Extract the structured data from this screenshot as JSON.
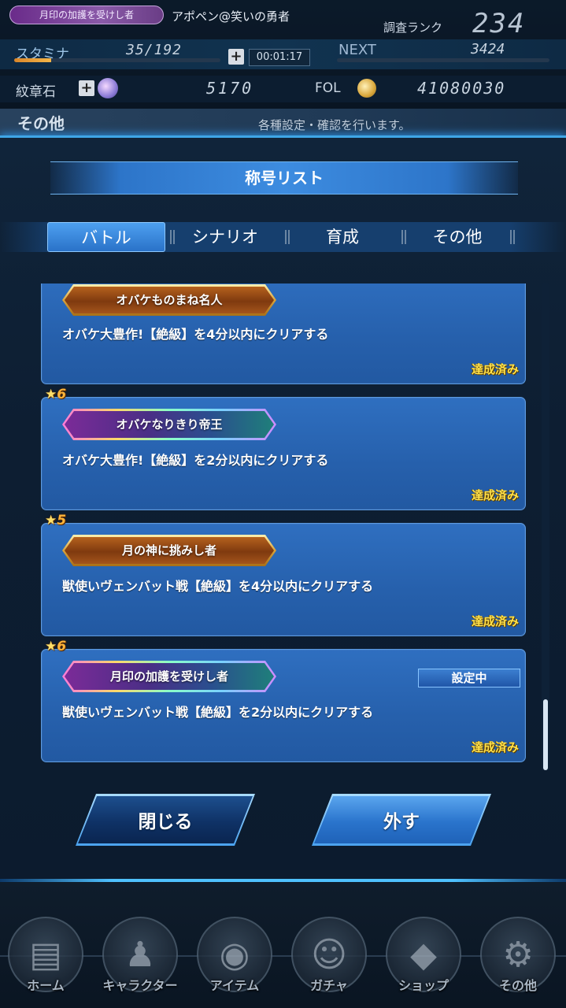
{
  "header": {
    "title_badge": "月印の加護を受けし者",
    "player_name": "アポペン@笑いの勇者",
    "rank_label": "調査ランク",
    "rank_value": "234",
    "stamina_label": "スタミナ",
    "stamina_value": "35/192",
    "stamina_fraction": 0.18,
    "timer": "00:01:17",
    "next_label": "NEXT",
    "next_value": "3424",
    "crest_label": "紋章石",
    "crest_value": "5170",
    "fol_label": "FOL",
    "fol_value": "41080030",
    "section_title": "その他",
    "section_desc": "各種設定・確認を行います。"
  },
  "modal": {
    "title": "称号リスト",
    "tabs": [
      {
        "label": "バトル",
        "active": true
      },
      {
        "label": "シナリオ",
        "active": false
      },
      {
        "label": "育成",
        "active": false
      },
      {
        "label": "その他",
        "active": false
      }
    ],
    "titles": [
      {
        "rarity": "",
        "name": "オバケものまね名人",
        "plate": "gold",
        "condition": "オバケ大豊作!【絶級】を4分以内にクリアする",
        "status": "達成済み",
        "equipped": false
      },
      {
        "rarity": "6",
        "name": "オバケなりきり帝王",
        "plate": "rainbow",
        "condition": "オバケ大豊作!【絶級】を2分以内にクリアする",
        "status": "達成済み",
        "equipped": false
      },
      {
        "rarity": "5",
        "name": "月の神に挑みし者",
        "plate": "gold",
        "condition": "獣使いヴェンバット戦【絶級】を4分以内にクリアする",
        "status": "達成済み",
        "equipped": false
      },
      {
        "rarity": "6",
        "name": "月印の加護を受けし者",
        "plate": "rainbow",
        "condition": "獣使いヴェンバット戦【絶級】を2分以内にクリアする",
        "status": "達成済み",
        "equipped": true,
        "equipped_label": "設定中"
      }
    ],
    "close_label": "閉じる",
    "remove_label": "外す"
  },
  "nav": [
    {
      "label": "ホーム",
      "icon": "home-door-icon"
    },
    {
      "label": "キャラクター",
      "icon": "character-group-icon"
    },
    {
      "label": "アイテム",
      "icon": "item-bag-icon"
    },
    {
      "label": "ガチャ",
      "icon": "gacha-girl-icon"
    },
    {
      "label": "ショップ",
      "icon": "shop-crystal-icon"
    },
    {
      "label": "その他",
      "icon": "gear-icon"
    }
  ]
}
